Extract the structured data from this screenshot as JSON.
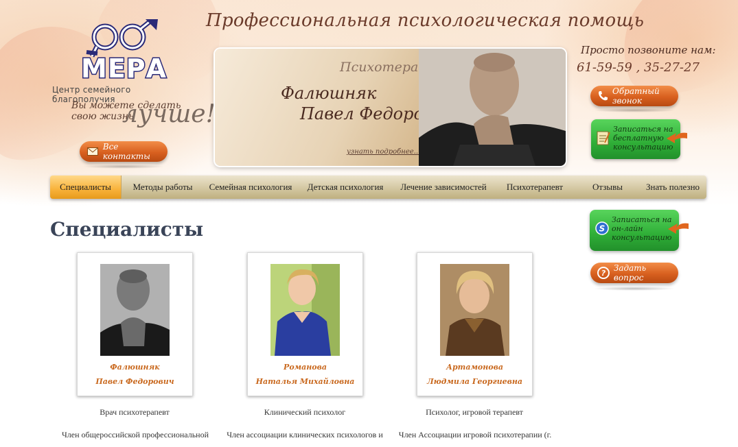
{
  "logo": {
    "name": "МЕРА",
    "subtitle": "Центр семейного благополучия",
    "slogan_line1": "Вы можете сделать",
    "slogan_line2": "свою жизнь",
    "slogan_big": "лучше!"
  },
  "header": {
    "title": "Профессиональная психологическая помощь"
  },
  "contacts_button": "Все контакты",
  "banner": {
    "role": "Психотерапевт",
    "name_line1": "Фалюшняк",
    "name_line2": "Павел Федорович",
    "more_link": "узнать подробнее..."
  },
  "phone": {
    "label": "Просто позвоните нам:",
    "numbers": "61-59-59 , 35-27-27"
  },
  "callback_button": "Обратный звонок",
  "free_consult_button": {
    "line1": "Записаться на",
    "line2": "бесплатную",
    "line3": "консультацию"
  },
  "online_consult_button": {
    "line1": "Записаться на",
    "line2": "он-лайн",
    "line3": "консультацию"
  },
  "ask_button": "Задать вопрос",
  "nav": {
    "items": [
      {
        "label": "Специалисты"
      },
      {
        "label": "Методы работы"
      },
      {
        "label": "Семейная психология"
      },
      {
        "label": "Детская психология"
      },
      {
        "label": "Лечение зависимостей"
      },
      {
        "label": "Психотерапевт"
      },
      {
        "label": "Отзывы"
      },
      {
        "label": "Знать полезно"
      }
    ],
    "active": "Специалисты"
  },
  "main": {
    "title": "Специалисты",
    "specialists": [
      {
        "surname": "Фалюшняк",
        "given": "Павел Федорович",
        "role": "Врач психотерапевт",
        "desc": "Член общероссийской профессиональной"
      },
      {
        "surname": "Романова",
        "given": "Наталья Михайловна",
        "role": "Клинический психолог",
        "desc": "Член ассоциации клинических психологов и"
      },
      {
        "surname": "Артамонова",
        "given": "Людмила Георгиевна",
        "role": "Психолог, игровой терапевт",
        "desc": "Член Ассоциации игровой психотерапии (г."
      }
    ]
  },
  "colors": {
    "accent_orange": "#d8601f",
    "name_orange": "#c9691f",
    "nav_active": "#f8b23a",
    "green_button": "#2fae37",
    "title_navy": "#3a4458",
    "logo_navy": "#2a2a78"
  }
}
